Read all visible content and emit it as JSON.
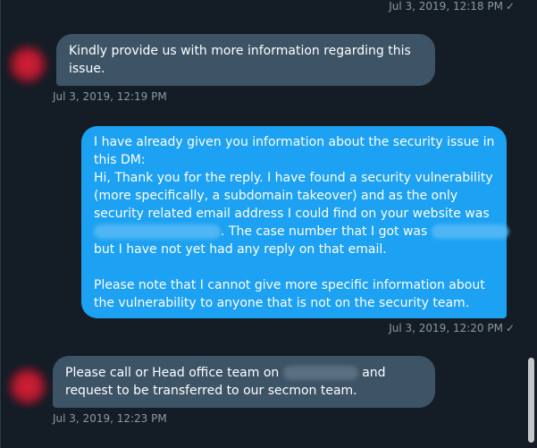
{
  "messages": [
    {
      "timestamp": "Jul 3, 2019, 12:18 PM",
      "read_mark": "✓"
    },
    {
      "lines": [
        "Kindly provide us with more information regarding this",
        "issue."
      ],
      "timestamp": "Jul 3, 2019, 12:19 PM"
    },
    {
      "lines": [
        "I have already given you information about the security issue in",
        "this DM:",
        "Hi, Thank you for the reply. I have found a security vulnerability",
        "(more  specifically, a subdomain takeover) and as the only",
        "security related  email address I could find on your website was",
        ". The  case number that I got was",
        "but I have not yet had any reply  on that email.",
        "Please note that I cannot give more specific information about",
        "the vulnerability to anyone that is not on the security team."
      ],
      "timestamp": "Jul 3, 2019, 12:20 PM",
      "read_mark": "✓"
    },
    {
      "lines": [
        "Please call or Head office team on",
        "and",
        "request to be transferred to our  secmon team."
      ],
      "timestamp": "Jul 3, 2019, 12:23 PM"
    }
  ],
  "colors": {
    "background": "#141d26",
    "received_bubble": "#3d5466",
    "sent_bubble": "#1da1f2",
    "meta_text": "#8899a6",
    "avatar": "#d22035"
  }
}
